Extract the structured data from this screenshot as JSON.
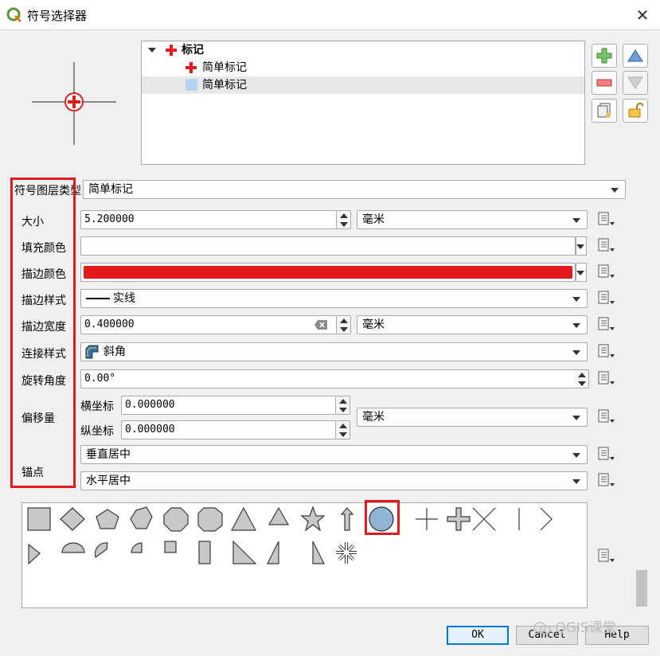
{
  "window": {
    "title": "符号选择器",
    "close_glyph": "✕"
  },
  "tree": {
    "items": [
      {
        "label": "标记",
        "icon": "red-cross-icon"
      },
      {
        "label": "简单标记",
        "icon": "red-cross-icon"
      },
      {
        "label": "简单标记",
        "icon": "blue-square-icon"
      }
    ]
  },
  "form": {
    "layer_type_label": "符号图层类型",
    "layer_type_value": "简单标记",
    "size_label": "大小",
    "size_value": "5.200000",
    "size_unit": "毫米",
    "fill_color_label": "填充颜色",
    "fill_color": "#ffffff",
    "stroke_color_label": "描边颜色",
    "stroke_color": "#e31a1c",
    "stroke_style_label": "描边样式",
    "stroke_style_value": "实线",
    "stroke_width_label": "描边宽度",
    "stroke_width_value": "0.400000",
    "stroke_width_unit": "毫米",
    "join_style_label": "连接样式",
    "join_style_value": "斜角",
    "rotation_label": "旋转角度",
    "rotation_value": "0.00°",
    "offset_label": "偏移量",
    "offset_x_label": "横坐标",
    "offset_x_value": "0.000000",
    "offset_y_label": "纵坐标",
    "offset_y_value": "0.000000",
    "offset_unit": "毫米",
    "anchor_label": "锚点",
    "anchor_vertical": "垂直居中",
    "anchor_horizontal": "水平居中"
  },
  "library": {
    "shapes": [
      "square",
      "diamond",
      "pentagon",
      "hexagon",
      "octagon",
      "decagon",
      "triangle",
      "equilateral-triangle",
      "star",
      "arrow",
      "circle",
      "cross",
      "cross-fill",
      "x",
      "line",
      "arrowhead",
      "filled-arrowhead",
      "half-circle",
      "third-circle",
      "quarter-circle",
      "quarter-square",
      "half-square",
      "diagonal-half-square",
      "right-half-triangle",
      "left-half-triangle",
      "asterisk"
    ],
    "selected": "circle"
  },
  "buttons": {
    "ok": "OK",
    "cancel": "Cancel",
    "help": "Help"
  },
  "watermark": "QGIS课堂",
  "colors": {
    "accent_red": "#e31a1c",
    "selected_shape_fill": "#8fb4d6"
  }
}
